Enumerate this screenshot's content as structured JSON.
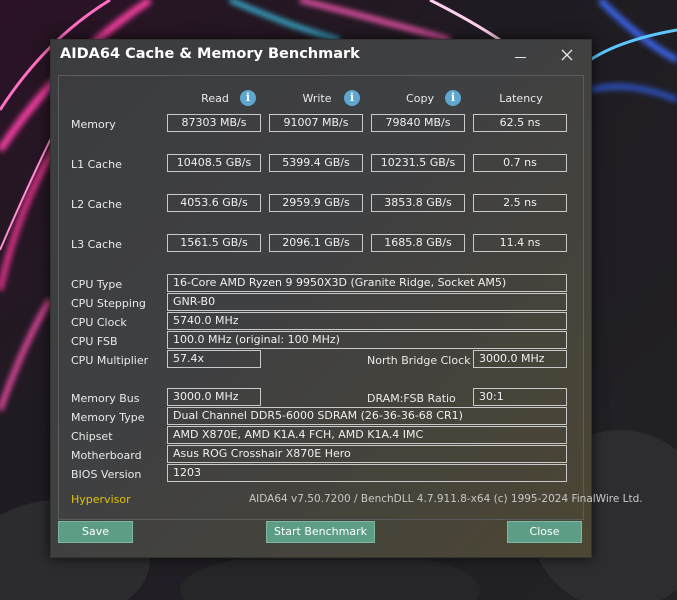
{
  "window": {
    "title": "AIDA64 Cache & Memory Benchmark"
  },
  "columns": {
    "read": "Read",
    "write": "Write",
    "copy": "Copy",
    "latency": "Latency"
  },
  "rows": [
    {
      "label": "Memory",
      "read": "87303 MB/s",
      "write": "91007 MB/s",
      "copy": "79840 MB/s",
      "latency": "62.5 ns"
    },
    {
      "label": "L1 Cache",
      "read": "10408.5 GB/s",
      "write": "5399.4 GB/s",
      "copy": "10231.5 GB/s",
      "latency": "0.7 ns"
    },
    {
      "label": "L2 Cache",
      "read": "4053.6 GB/s",
      "write": "2959.9 GB/s",
      "copy": "3853.8 GB/s",
      "latency": "2.5 ns"
    },
    {
      "label": "L3 Cache",
      "read": "1561.5 GB/s",
      "write": "2096.1 GB/s",
      "copy": "1685.8 GB/s",
      "latency": "11.4 ns"
    }
  ],
  "cpu": {
    "type_label": "CPU Type",
    "type": "16-Core AMD Ryzen 9 9950X3D  (Granite Ridge, Socket AM5)",
    "stepping_label": "CPU Stepping",
    "stepping": "GNR-B0",
    "clock_label": "CPU Clock",
    "clock": "5740.0 MHz",
    "fsb_label": "CPU FSB",
    "fsb": "100.0 MHz  (original: 100 MHz)",
    "multiplier_label": "CPU Multiplier",
    "multiplier": "57.4x",
    "nb_clock_label": "North Bridge Clock",
    "nb_clock": "3000.0 MHz"
  },
  "memory": {
    "bus_label": "Memory Bus",
    "bus": "3000.0 MHz",
    "ratio_label": "DRAM:FSB Ratio",
    "ratio": "30:1",
    "type_label": "Memory Type",
    "type": "Dual Channel DDR5-6000 SDRAM  (26-36-36-68 CR1)",
    "chipset_label": "Chipset",
    "chipset": "AMD X870E, AMD K1A.4 FCH, AMD K1A.4 IMC",
    "motherboard_label": "Motherboard",
    "motherboard": "Asus ROG Crosshair X870E Hero",
    "bios_label": "BIOS Version",
    "bios": "1203"
  },
  "footer": {
    "hypervisor": "Hypervisor",
    "version": "AIDA64 v7.50.7200 / BenchDLL 4.7.911.8-x64  (c) 1995-2024 FinalWire Ltd."
  },
  "buttons": {
    "save": "Save",
    "start": "Start Benchmark",
    "close": "Close"
  },
  "colors": {
    "button_bg": "#5d9d86",
    "hypervisor_text": "#e0c200",
    "info_icon": "#5ea7cf"
  },
  "icons": {
    "info": "info-icon",
    "minimize": "minimize-icon",
    "close": "close-icon"
  }
}
